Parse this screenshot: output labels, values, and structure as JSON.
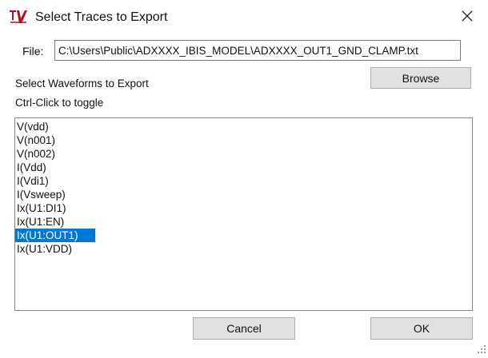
{
  "window": {
    "title": "Select Traces to Export"
  },
  "file": {
    "label": "File:",
    "value": "C:\\Users\\Public\\ADXXXX_IBIS_MODEL\\ADXXXX_OUT1_GND_CLAMP.txt"
  },
  "labels": {
    "select_waveforms": "Select Waveforms to Export",
    "ctrl_click": "Ctrl-Click to toggle"
  },
  "buttons": {
    "browse": "Browse",
    "cancel": "Cancel",
    "ok": "OK"
  },
  "waveforms": {
    "items": [
      "V(vdd)",
      "V(n001)",
      "V(n002)",
      "I(Vdd)",
      "I(Vdi1)",
      "I(Vsweep)",
      "Ix(U1:DI1)",
      "Ix(U1:EN)",
      "Ix(U1:OUT1)",
      "Ix(U1:VDD)"
    ],
    "selected": "Ix(U1:OUT1)"
  },
  "colors": {
    "selection": "#0078d7",
    "button_face": "#e1e1e1",
    "app_icon": "#b01218"
  }
}
